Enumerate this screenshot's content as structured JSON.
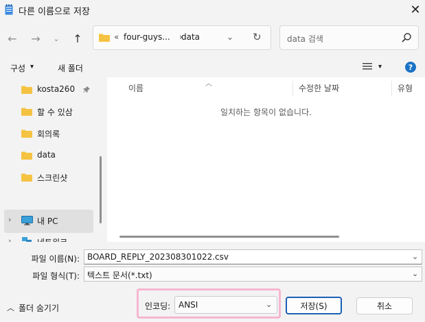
{
  "window": {
    "title": "다른 이름으로 저장"
  },
  "nav": {
    "address_chevron": "«",
    "address_segments": [
      "four-guys...",
      "data"
    ],
    "search_placeholder": "data 검색"
  },
  "toolbar": {
    "organize": "구성",
    "new_folder": "새 폴더"
  },
  "sidebar": {
    "items": [
      {
        "label": "kosta260",
        "pinned": true
      },
      {
        "label": "할 수 있삼"
      },
      {
        "label": "회의록"
      },
      {
        "label": "data"
      },
      {
        "label": "스크린샷"
      }
    ],
    "this_pc": "내 PC",
    "network": "네트워크"
  },
  "content": {
    "columns": [
      "이름",
      "수정한 날짜",
      "유형"
    ],
    "empty_message": "일치하는 항목이 없습니다."
  },
  "form": {
    "filename_label": "파일 이름(N):",
    "filename_value": "BOARD_REPLY_202308301022.csv",
    "filetype_label": "파일 형식(T):",
    "filetype_value": "텍스트 문서(*.txt)",
    "hide_folders": "폴더 숨기기",
    "encoding_label": "인코딩:",
    "encoding_value": "ANSI",
    "save_button": "저장(S)",
    "cancel_button": "취소"
  },
  "colors": {
    "accent": "#1a5fb4",
    "highlight_frame": "#f6b6d0",
    "folder": "#f5c342"
  }
}
